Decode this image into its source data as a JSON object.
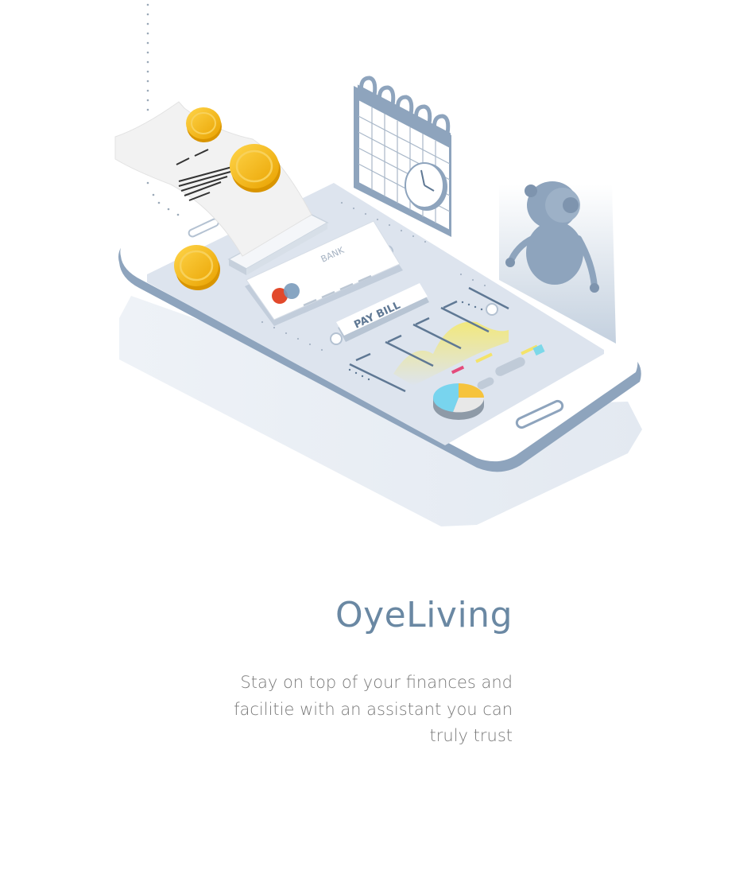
{
  "app": {
    "title": "OyeLiving",
    "tagline_lines": [
      "Stay on top of your finances and",
      "facilitie with an assistant you can",
      "truly trust"
    ]
  },
  "illustration": {
    "card_label": "BANK",
    "pay_button_label": "PAY BILL"
  },
  "colors": {
    "accent": "#6a88a3",
    "body_text": "#7a7a7a",
    "coin": "#f2b705",
    "phone_frame": "#8ea4bd",
    "screen": "#dde4ee"
  },
  "icons": [
    "receipt-icon",
    "coin-icon",
    "calendar-icon",
    "clock-icon",
    "robot-icon",
    "bank-card-icon",
    "pie-chart-icon"
  ]
}
